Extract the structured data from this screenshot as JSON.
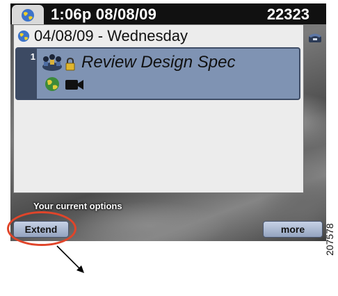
{
  "header": {
    "clock": "1:06p 08/08/09",
    "extension": "22323"
  },
  "calendar": {
    "date_label": "04/08/09 - Wednesday",
    "meeting": {
      "line_number": "1",
      "subject": "Review Design Spec"
    }
  },
  "options_label": "Your current options",
  "softkeys": {
    "extend": "Extend",
    "more": "more"
  },
  "figure_number": "207578",
  "colors": {
    "highlight": "#7f93b3",
    "callout": "#e0452a",
    "topbar": "#111111"
  },
  "icons": [
    "globe-icon",
    "conference-icon",
    "lock-icon",
    "web-icon",
    "video-camera-icon",
    "phone-icon"
  ]
}
